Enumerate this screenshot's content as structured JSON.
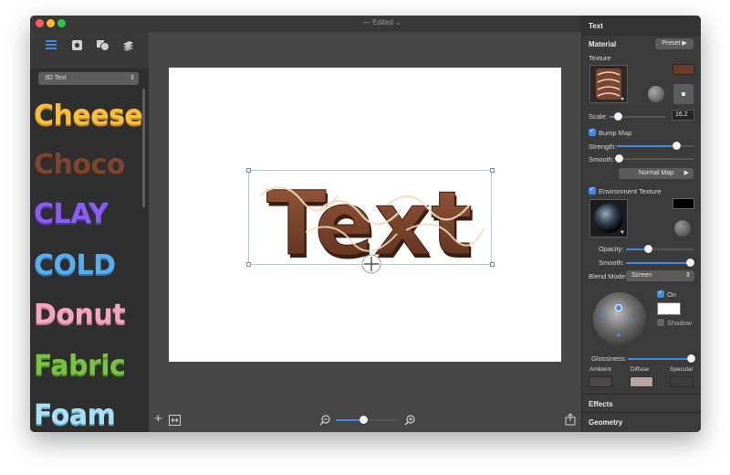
{
  "window": {
    "title": "— Edited"
  },
  "sidebar": {
    "category": "3D Text",
    "presets": [
      {
        "label": "Cheese",
        "color": "#f7bf3c"
      },
      {
        "label": "Choco",
        "color": "#7a4630"
      },
      {
        "label": "CLAY",
        "color": "#8b5cf6"
      },
      {
        "label": "COLD",
        "color": "#5aaee8"
      },
      {
        "label": "Donut",
        "color": "#f4a6c0"
      },
      {
        "label": "Fabric",
        "color": "#79c342"
      },
      {
        "label": "Foam",
        "color": "#a9e0f5"
      }
    ]
  },
  "canvas": {
    "art_text": "Text",
    "zoom_level": 0.45
  },
  "inspector": {
    "header": "Text",
    "material": "Material",
    "preset_btn": "Preset",
    "texture": "Texture",
    "scale_label": "Scale:",
    "scale_value": "16.2",
    "scale_level": 0.16,
    "bump_map": "Bump Map",
    "strength_label": "Strength:",
    "strength_level": 0.78,
    "smooth_label": "Smooth:",
    "smooth_level": 0.0,
    "normal_map_btn": "Normal Map",
    "env_texture": "Environment Texture",
    "opacity_label": "Opacity:",
    "opacity_level": 0.33,
    "env_smooth_label": "Smooth:",
    "env_smooth_level": 0.95,
    "blend_mode_label": "Blend Mode:",
    "blend_mode_value": "Screen",
    "on_label": "On",
    "shadow_label": "Shadow",
    "glossiness_label": "Glossiness:",
    "glossiness_level": 0.96,
    "ambient_label": "Ambient",
    "diffuse_label": "Diffuse",
    "specular_label": "Specular",
    "effects_label": "Effects",
    "geometry_label": "Geometry",
    "colors": {
      "texture_color": "#6e3b28",
      "env_color": "#000000",
      "light_color": "#ffffff",
      "ambient": "#4f4747",
      "diffuse": "#b9a3a3",
      "specular": "#3d3d3d"
    }
  }
}
